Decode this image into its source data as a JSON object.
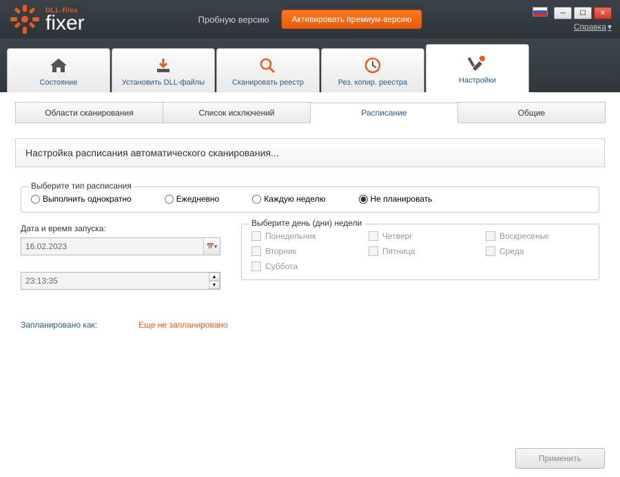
{
  "titlebar": {
    "logo_dll": "DLL-files",
    "logo_fixer": "fixer",
    "trial": "Пробную версию",
    "activate": "Активировать премиум-версию",
    "help": "Справка"
  },
  "main_tabs": [
    {
      "label": "Состояние",
      "icon": "home"
    },
    {
      "label": "Установить DLL-файлы",
      "icon": "download"
    },
    {
      "label": "Сканировать реестр",
      "icon": "search"
    },
    {
      "label": "Рез. копир. реестра",
      "icon": "clock"
    },
    {
      "label": "Настройки",
      "icon": "tools"
    }
  ],
  "main_tab_active": 4,
  "sub_tabs": [
    "Области сканирования",
    "Список исключений",
    "Расписание",
    "Общие"
  ],
  "sub_tab_active": 2,
  "panel_title": "Настройка расписания автоматического сканирования...",
  "schedule_type_legend": "Выберите тип расписания",
  "schedule_options": [
    "Выполнить однократно",
    "Ежедневно",
    "Каждую неделю",
    "Не планировать"
  ],
  "schedule_selected": 3,
  "datetime_label": "Дата и время запуска:",
  "date_value": "16.02.2023",
  "time_value": "23:13:35",
  "days_legend": "Выберите день (дни) недели",
  "days": [
    "Понедельник",
    "Четверг",
    "Воскресенье",
    "Вторник",
    "Пятница",
    "Среда",
    "Суббота"
  ],
  "status_label": "Запланировано как:",
  "status_value": "Еще не запланировано",
  "apply": "Применить"
}
